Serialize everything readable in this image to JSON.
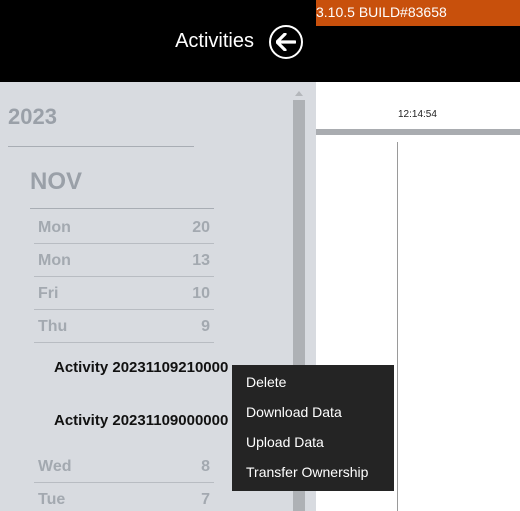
{
  "header": {
    "build": "3.10.5 BUILD#83658",
    "title": "Activities"
  },
  "sidebar": {
    "year": "2023",
    "month": "NOV",
    "days_top": [
      {
        "weekday": "Mon",
        "day": "20"
      },
      {
        "weekday": "Mon",
        "day": "13"
      },
      {
        "weekday": "Fri",
        "day": "10"
      },
      {
        "weekday": "Thu",
        "day": "9"
      }
    ],
    "activities": [
      "Activity 20231109210000",
      "Activity 20231109000000"
    ],
    "days_bottom": [
      {
        "weekday": "Wed",
        "day": "8"
      },
      {
        "weekday": "Tue",
        "day": "7"
      }
    ]
  },
  "timeline": {
    "time": "12:14:54"
  },
  "context_menu": {
    "items": [
      "Delete",
      "Download Data",
      "Upload Data",
      "Transfer Ownership"
    ]
  },
  "colors": {
    "accent": "#c8500c",
    "topbar": "#000000",
    "sidebar": "#d8dbe0",
    "menu": "#242424"
  }
}
